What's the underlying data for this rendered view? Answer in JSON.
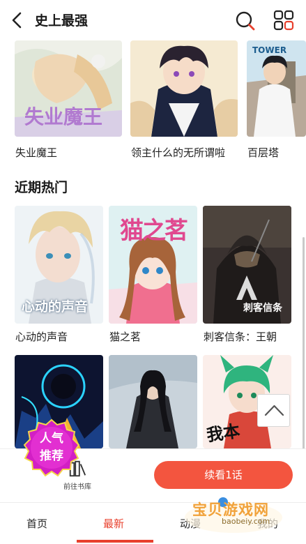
{
  "header": {
    "title": "史上最强"
  },
  "top_row": [
    {
      "title": "失业魔王",
      "cover_text": "失业魔王"
    },
    {
      "title": "领主什么的无所谓啦"
    },
    {
      "title": "百层塔"
    }
  ],
  "section": {
    "title": "近期热门"
  },
  "hot_row": [
    {
      "title": "心动的声音",
      "cover_text": "心动的声音"
    },
    {
      "title": "猫之茗",
      "cover_text": "猫之茗"
    },
    {
      "title": "刺客信条：王朝",
      "cover_text": "刺客信条"
    }
  ],
  "promo": {
    "line1": "人气",
    "line2": "推荐"
  },
  "action_bar": {
    "bookshelf_label": "前往书库",
    "continue_label": "续看1话"
  },
  "bottom_nav": [
    {
      "label": "首页"
    },
    {
      "label": "最新",
      "active": true
    },
    {
      "label": "动漫"
    },
    {
      "label": "我的"
    }
  ],
  "watermark": {
    "title": "宝贝游戏网",
    "url": "baobeiy.com"
  },
  "colors": {
    "accent": "#e8402d",
    "button": "#f3553f",
    "promo": "#d21fc4"
  }
}
